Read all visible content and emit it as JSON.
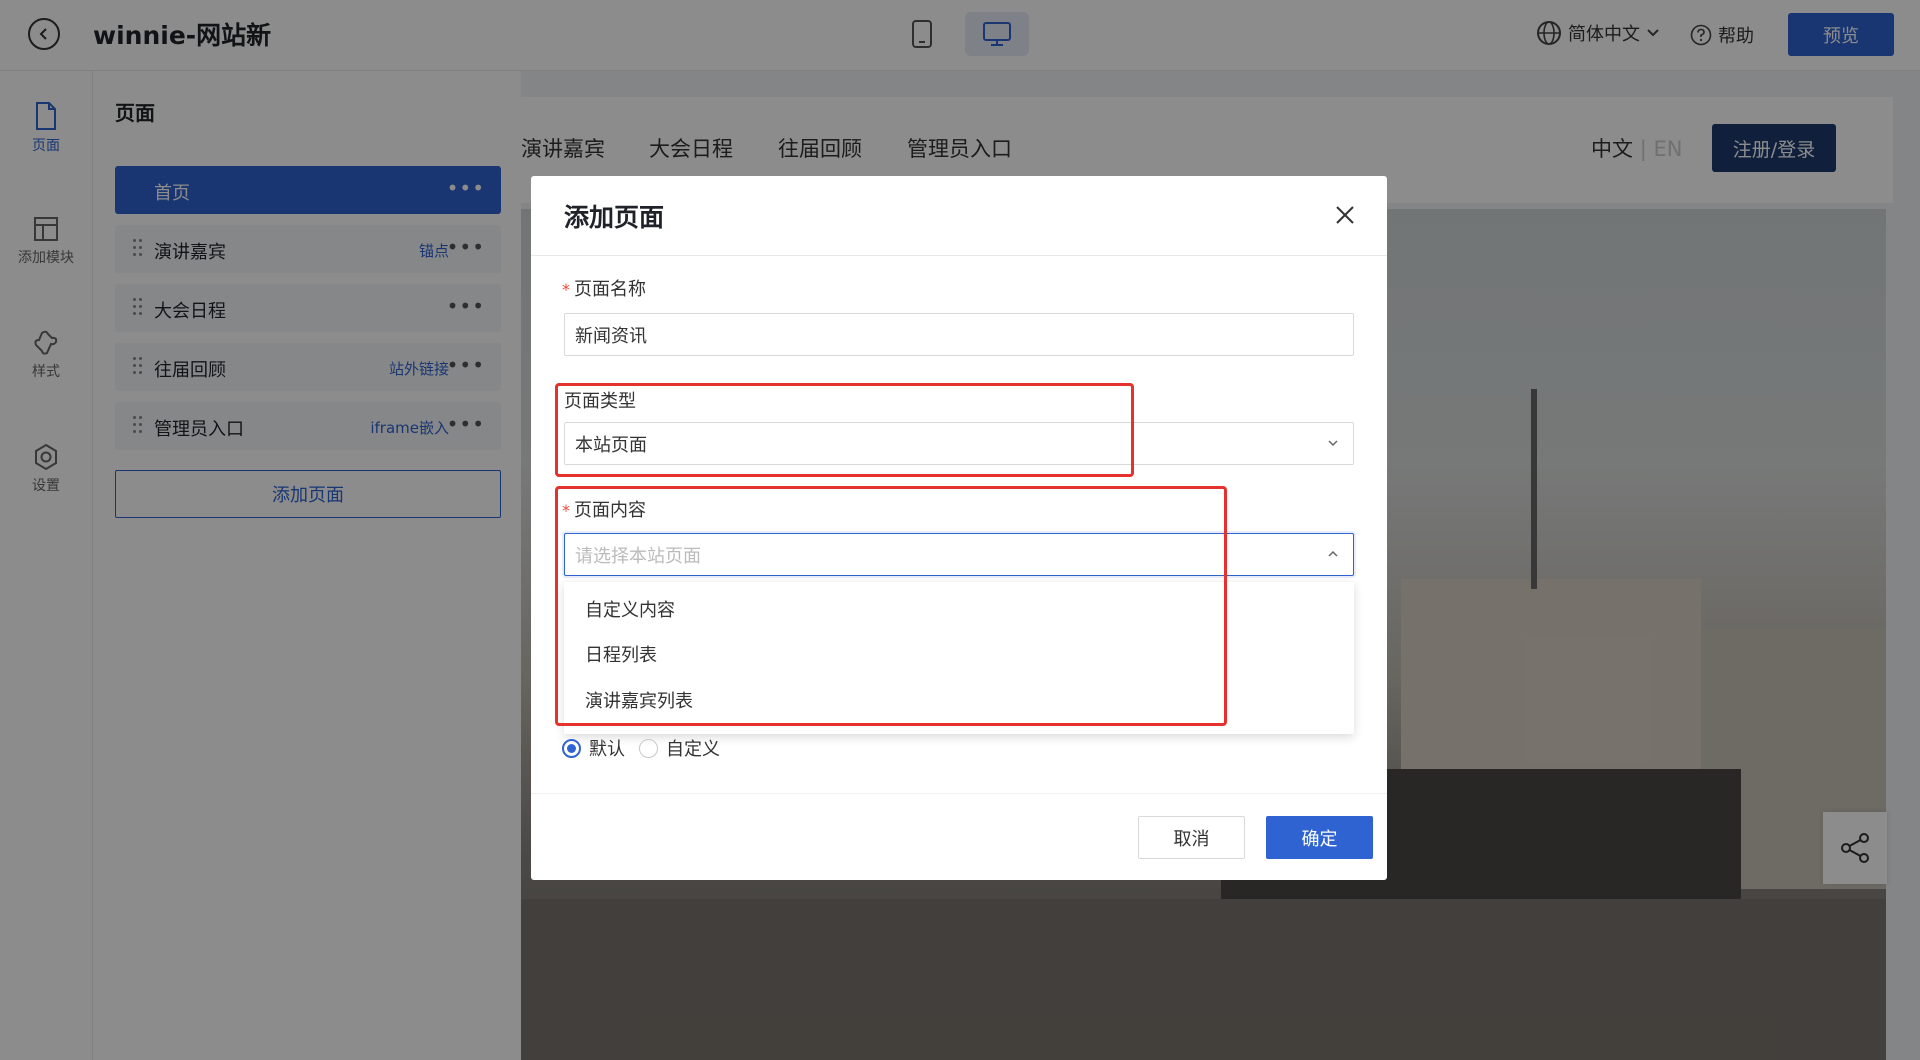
{
  "header": {
    "title": "winnie-网站新",
    "language": "简体中文",
    "help_label": "帮助",
    "preview_label": "预览"
  },
  "rail": {
    "items": [
      {
        "label": "页面",
        "icon": "file-icon"
      },
      {
        "label": "添加模块",
        "icon": "layout-icon"
      },
      {
        "label": "样式",
        "icon": "puzzle-icon"
      },
      {
        "label": "设置",
        "icon": "gear-icon"
      }
    ]
  },
  "panel": {
    "title": "页面",
    "pages": [
      {
        "name": "首页",
        "tag": ""
      },
      {
        "name": "演讲嘉宾",
        "tag": "锚点"
      },
      {
        "name": "大会日程",
        "tag": ""
      },
      {
        "name": "往届回顾",
        "tag": "站外链接"
      },
      {
        "name": "管理员入口",
        "tag": "iframe嵌入"
      }
    ],
    "add_page_label": "添加页面"
  },
  "site": {
    "nav": [
      "演讲嘉宾",
      "大会日程",
      "往届回顾",
      "管理员入口"
    ],
    "lang_zh": "中文",
    "lang_sep": "|",
    "lang_en": "EN",
    "login_label": "注册/登录"
  },
  "modal": {
    "title": "添加页面",
    "name_label": "页面名称",
    "name_value": "新闻资讯",
    "type_label": "页面类型",
    "type_value": "本站页面",
    "content_label": "页面内容",
    "content_placeholder": "请选择本站页面",
    "content_options": [
      "自定义内容",
      "日程列表",
      "演讲嘉宾列表"
    ],
    "radio_default": "默认",
    "radio_custom": "自定义",
    "cancel_label": "取消",
    "ok_label": "确定"
  },
  "colors": {
    "accent": "#2f63d2",
    "highlight": "#e5322d"
  }
}
